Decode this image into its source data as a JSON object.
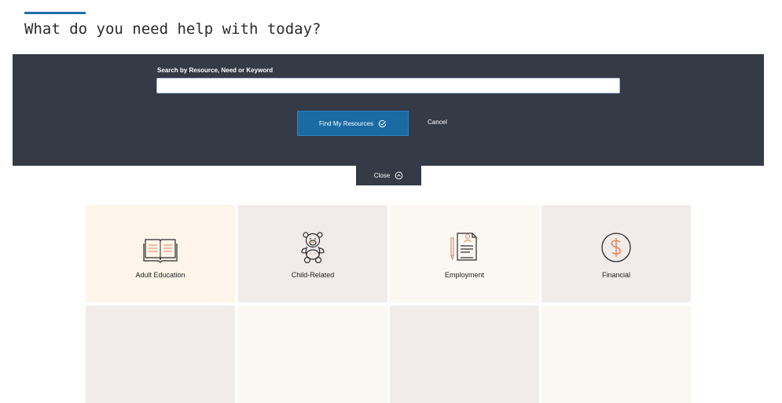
{
  "heading": "What do you need help with today?",
  "search": {
    "label": "Search by Resource, Need or Keyword",
    "value": "",
    "find_label": "Find My Resources",
    "cancel_label": "Cancel",
    "close_label": "Close"
  },
  "categories": [
    {
      "label": "Adult Education",
      "icon": "book-icon"
    },
    {
      "label": "Child-Related",
      "icon": "teddy-bear-icon"
    },
    {
      "label": "Employment",
      "icon": "resume-pencil-icon"
    },
    {
      "label": "Financial",
      "icon": "dollar-coin-icon"
    }
  ],
  "colors": {
    "accent": "#1f6fa8",
    "panel": "#343a46",
    "button": "#1a6aa3",
    "icon_stroke": "#2b2b2b",
    "icon_highlight": "#e8835a"
  }
}
